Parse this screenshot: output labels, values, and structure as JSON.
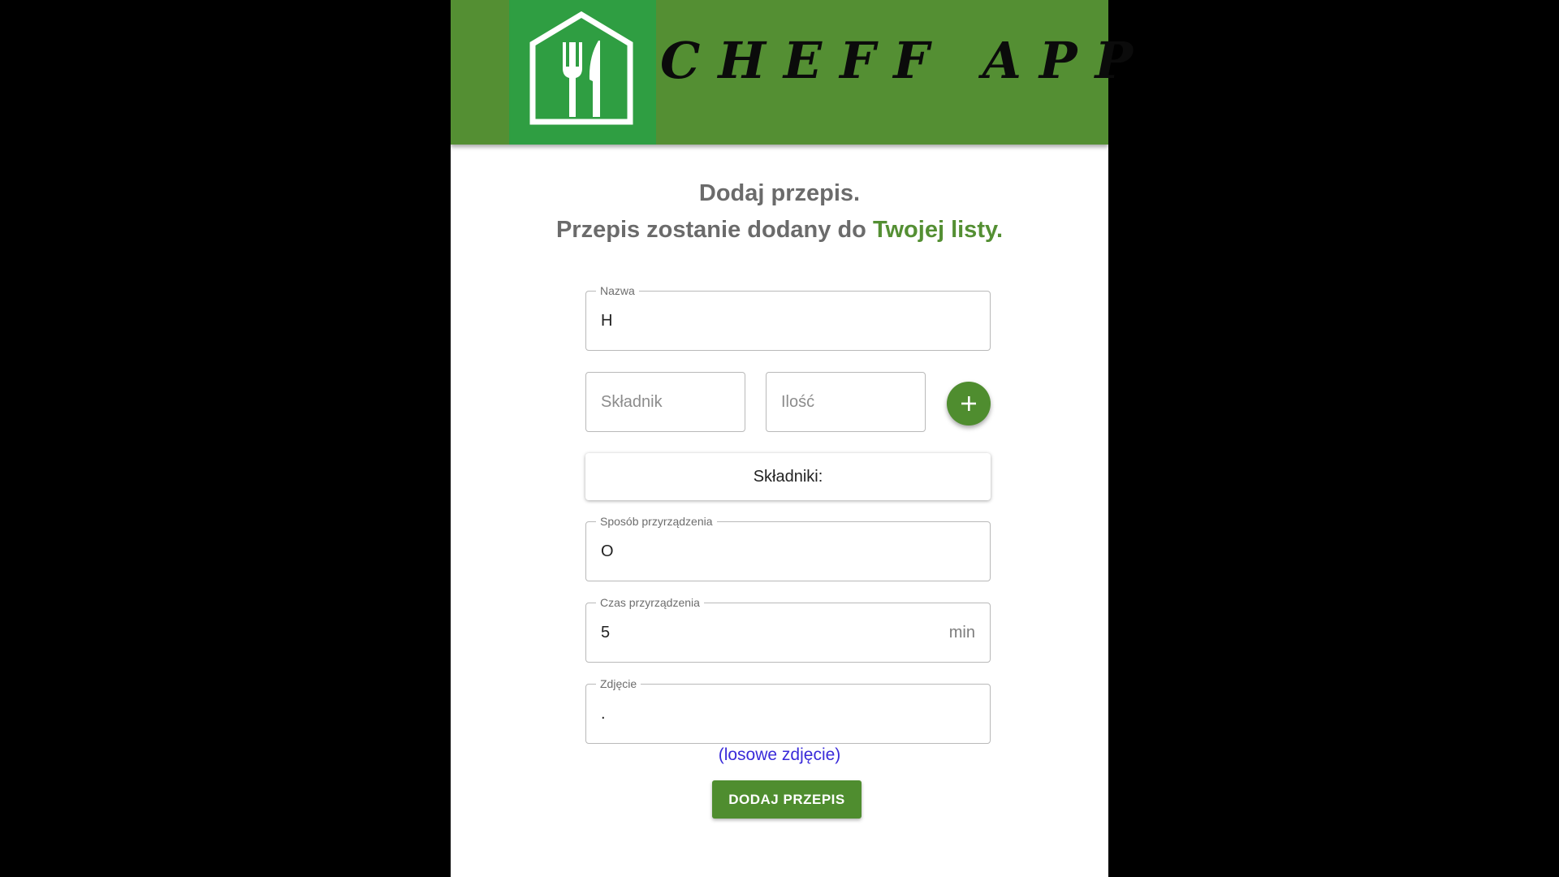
{
  "header": {
    "brand": "CHEFF APP",
    "logo_icon": "house-fork-knife-icon"
  },
  "title": {
    "line1": "Dodaj przepis.",
    "line2_prefix": "Przepis zostanie dodany do ",
    "line2_accent": "Twojej listy."
  },
  "form": {
    "name": {
      "label": "Nazwa",
      "value": "H"
    },
    "ingredient": {
      "placeholder": "Składnik"
    },
    "quantity": {
      "placeholder": "Ilość"
    },
    "add_icon": "plus-icon",
    "ingredients_heading": "Składniki:",
    "preparation": {
      "label": "Sposób przyrządzenia",
      "value": "O"
    },
    "time": {
      "label": "Czas przyrządzenia",
      "value": "5",
      "unit": "min"
    },
    "photo": {
      "label": "Zdjęcie",
      "value": "."
    },
    "random_photo_link": "(losowe zdjęcie)",
    "submit_label": "DODAJ PRZEPIS"
  },
  "colors": {
    "header_green": "#548f33",
    "logo_green": "#2f9e42",
    "button_green": "#4f8d2f",
    "link_blue": "#3a2bd9"
  }
}
